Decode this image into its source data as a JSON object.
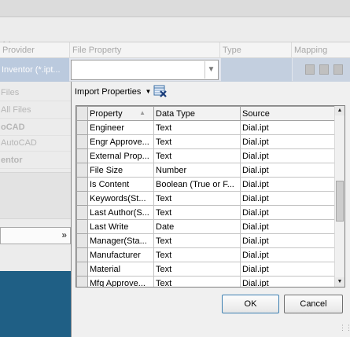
{
  "background": {
    "close_glyph": "✕",
    "header": {
      "provider": "Provider",
      "file_property": "File Property",
      "type": "Type",
      "mapping": "Mapping"
    },
    "row": {
      "provider": "Inventor (*.ipt..."
    },
    "left_items": [
      {
        "label": "Files",
        "bold": true
      },
      {
        "label": "All Files",
        "bold": false
      },
      {
        "label": "oCAD",
        "bold": true
      },
      {
        "label": "AutoCAD",
        "bold": false
      },
      {
        "label": "entor",
        "bold": true
      }
    ],
    "combo_chevron": "»"
  },
  "dialog": {
    "import_label": "Import Properties",
    "import_arrow": "▼",
    "clear_icon": "clear-grid-icon",
    "columns": {
      "property": "Property",
      "data_type": "Data Type",
      "source": "Source"
    },
    "sort_glyph": "▲",
    "rows": [
      {
        "property": "Engineer",
        "data_type": "Text",
        "source": "Dial.ipt"
      },
      {
        "property": "Engr Approve...",
        "data_type": "Text",
        "source": "Dial.ipt"
      },
      {
        "property": "External Prop...",
        "data_type": "Text",
        "source": "Dial.ipt"
      },
      {
        "property": "File Size",
        "data_type": "Number",
        "source": "Dial.ipt"
      },
      {
        "property": "Is Content",
        "data_type": "Boolean (True or F...",
        "source": "Dial.ipt"
      },
      {
        "property": "Keywords(St...",
        "data_type": "Text",
        "source": "Dial.ipt"
      },
      {
        "property": "Last Author(S...",
        "data_type": "Text",
        "source": "Dial.ipt"
      },
      {
        "property": "Last Write",
        "data_type": "Date",
        "source": "Dial.ipt"
      },
      {
        "property": "Manager(Sta...",
        "data_type": "Text",
        "source": "Dial.ipt"
      },
      {
        "property": "Manufacturer",
        "data_type": "Text",
        "source": "Dial.ipt"
      },
      {
        "property": "Material",
        "data_type": "Text",
        "source": "Dial.ipt"
      },
      {
        "property": "Mfg Approve...",
        "data_type": "Text",
        "source": "Dial.ipt"
      }
    ],
    "scroll_up": "▲",
    "scroll_down": "▼",
    "ok_label": "OK",
    "cancel_label": "Cancel",
    "accent_color": "#3c7fb1"
  }
}
